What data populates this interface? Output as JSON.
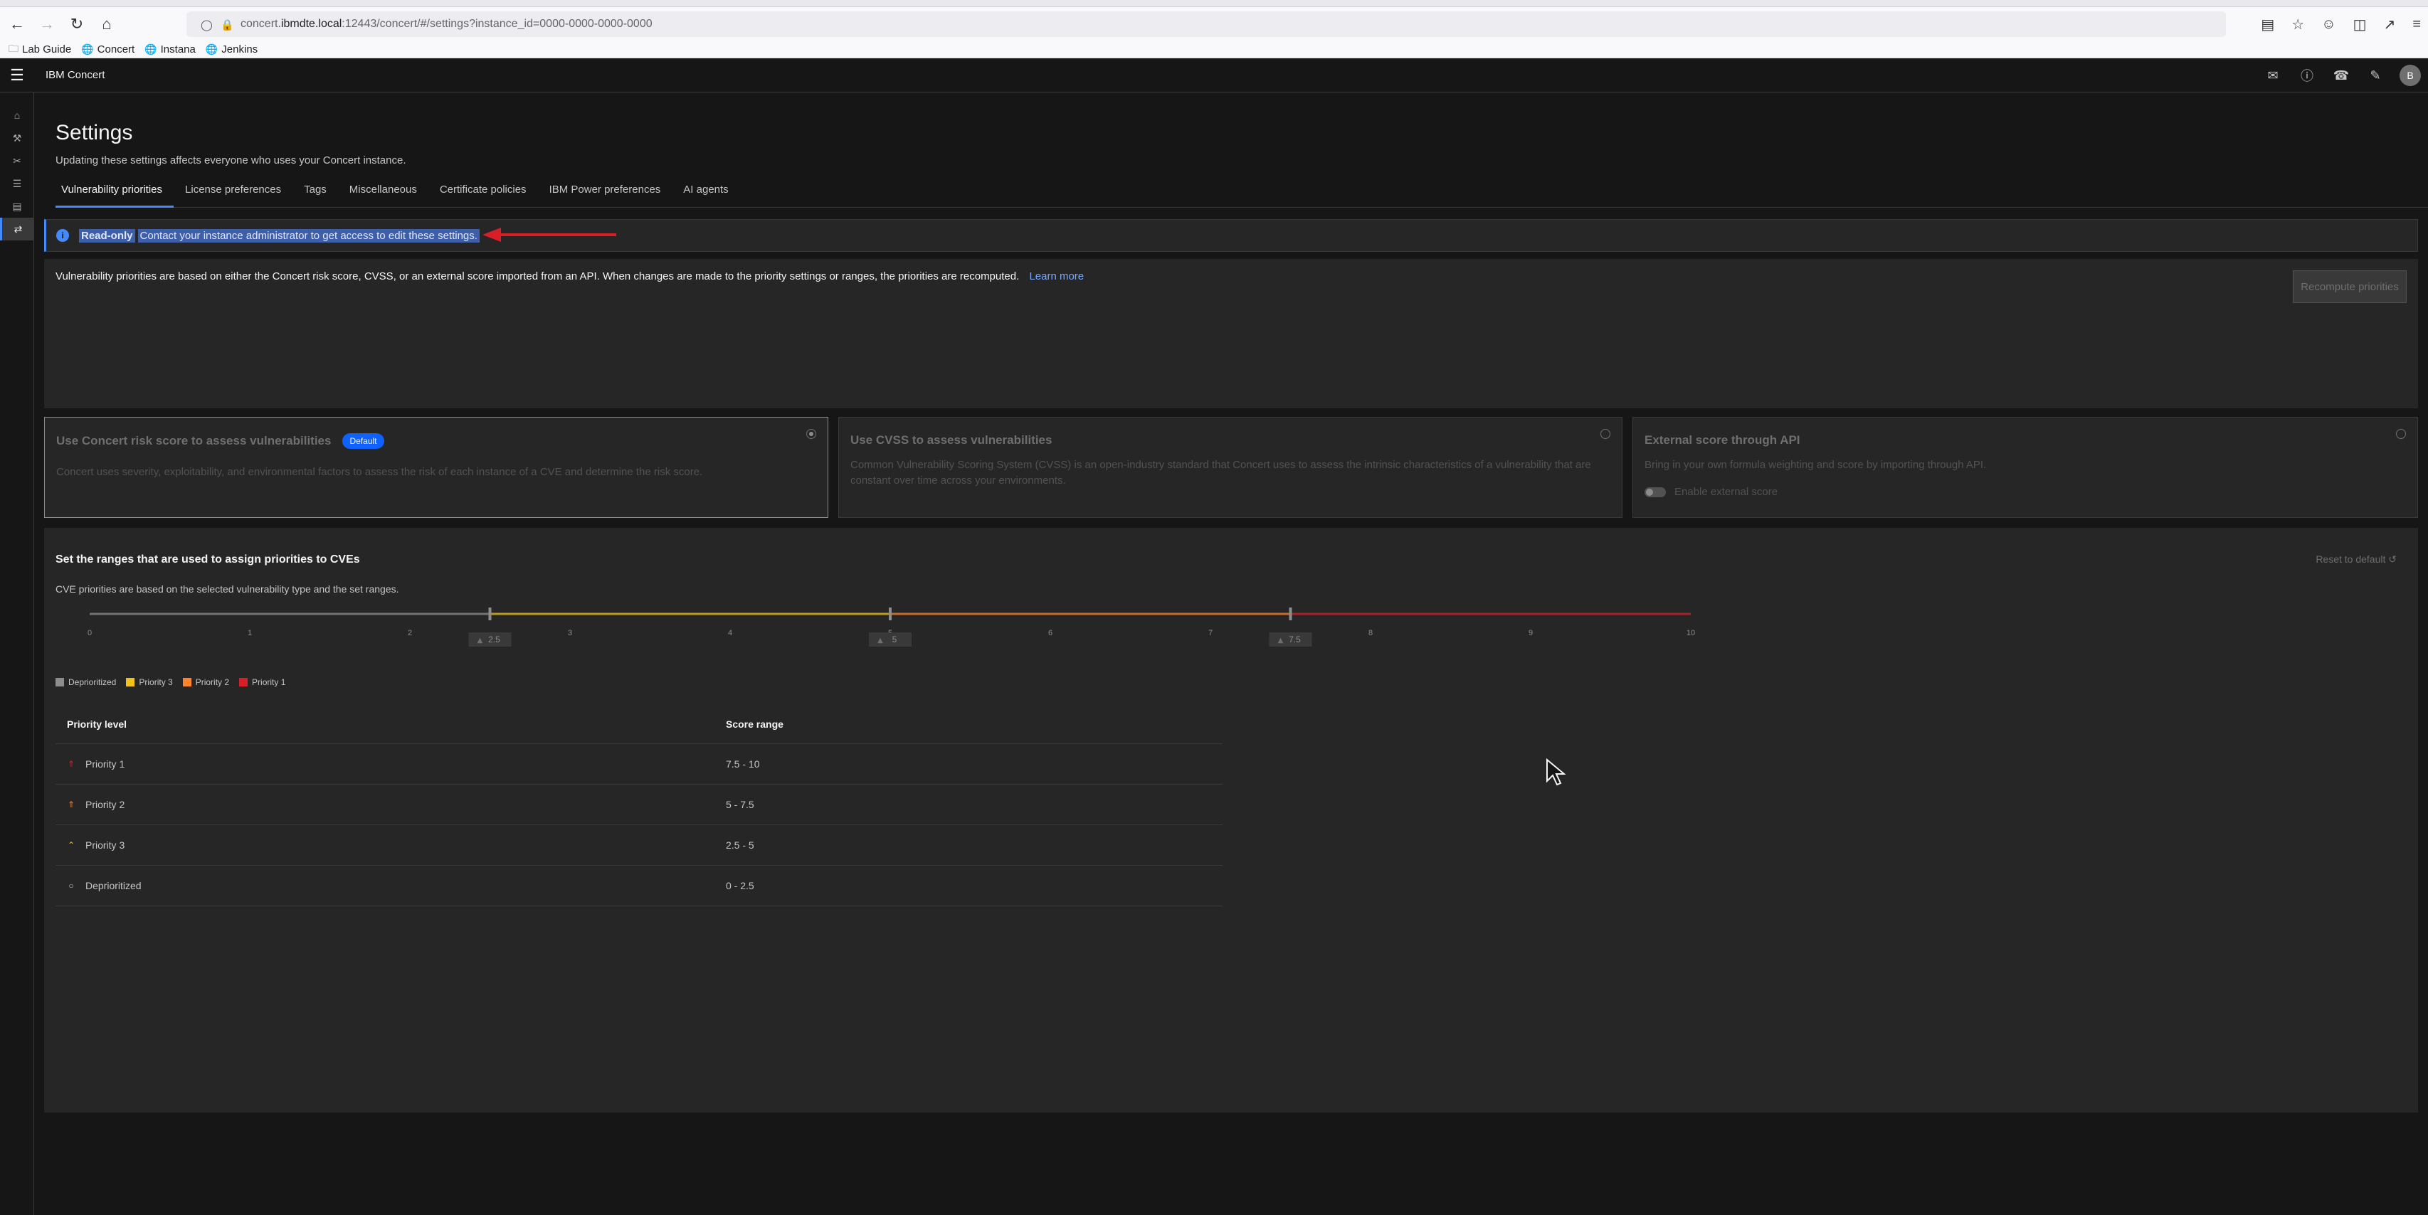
{
  "browser": {
    "url_prefix": "concert.",
    "url_host": "ibmdte.local",
    "url_rest": ":12443/concert/#/settings?instance_id=0000-0000-0000-0000",
    "bookmarks": [
      "Lab Guide",
      "Concert",
      "Instana",
      "Jenkins"
    ]
  },
  "app": {
    "name": "IBM Concert",
    "avatar_initial": "B"
  },
  "page": {
    "title": "Settings",
    "subtitle": "Updating these settings affects everyone who uses your Concert instance."
  },
  "tabs": [
    "Vulnerability priorities",
    "License preferences",
    "Tags",
    "Miscellaneous",
    "Certificate policies",
    "IBM Power preferences",
    "AI agents"
  ],
  "notification": {
    "title": "Read-only",
    "message": "Contact your instance administrator to get access to edit these settings."
  },
  "description": {
    "text": "Vulnerability priorities are based on either the Concert risk score, CVSS, or an external score imported from an API. When changes are made to the priority settings or ranges, the priorities are recomputed.",
    "link": "Learn more",
    "button": "Recompute priorities"
  },
  "tiles": [
    {
      "title": "Use Concert risk score to assess vulnerabilities",
      "badge": "Default",
      "text": "Concert uses severity, exploitability, and environmental factors to assess the risk of each instance of a CVE and determine the risk score.",
      "selected": true
    },
    {
      "title": "Use CVSS to assess vulnerabilities",
      "text": "Common Vulnerability Scoring System (CVSS) is an open-industry standard that Concert uses to assess the intrinsic characteristics of a vulnerability that are constant over time across your environments.",
      "selected": false
    },
    {
      "title": "External score through API",
      "text": "Bring in your own formula weighting and score by importing through API.",
      "toggle_label": "Enable external score",
      "selected": false
    }
  ],
  "ranges": {
    "title": "Set the ranges that are used to assign priorities to CVEs",
    "subtitle": "CVE priorities are based on the selected vulnerability type and the set ranges.",
    "reset": "Reset to default",
    "ticks": [
      "0",
      "1",
      "2",
      "3",
      "4",
      "5",
      "6",
      "7",
      "8",
      "9",
      "10"
    ],
    "thresholds": [
      {
        "value": 2.5,
        "label": "2.5"
      },
      {
        "value": 5,
        "label": "5"
      },
      {
        "value": 7.5,
        "label": "7.5"
      }
    ],
    "min": 0,
    "max": 10,
    "colors": {
      "deprioritized": "#8d8d8d",
      "p3": "#f1c21b",
      "p2": "#ff832b",
      "p1": "#da1e28"
    },
    "legend": [
      "Deprioritized",
      "Priority 3",
      "Priority 2",
      "Priority 1"
    ]
  },
  "table": {
    "headers": [
      "Priority level",
      "Score range"
    ],
    "rows": [
      {
        "level": "Priority 1",
        "range": "7.5 - 10",
        "icon": "priority-1-icon"
      },
      {
        "level": "Priority 2",
        "range": "5 - 7.5",
        "icon": "priority-2-icon"
      },
      {
        "level": "Priority 3",
        "range": "2.5 - 5",
        "icon": "priority-3-icon"
      },
      {
        "level": "Deprioritized",
        "range": "0 - 2.5",
        "icon": "deprioritized-icon"
      }
    ]
  }
}
